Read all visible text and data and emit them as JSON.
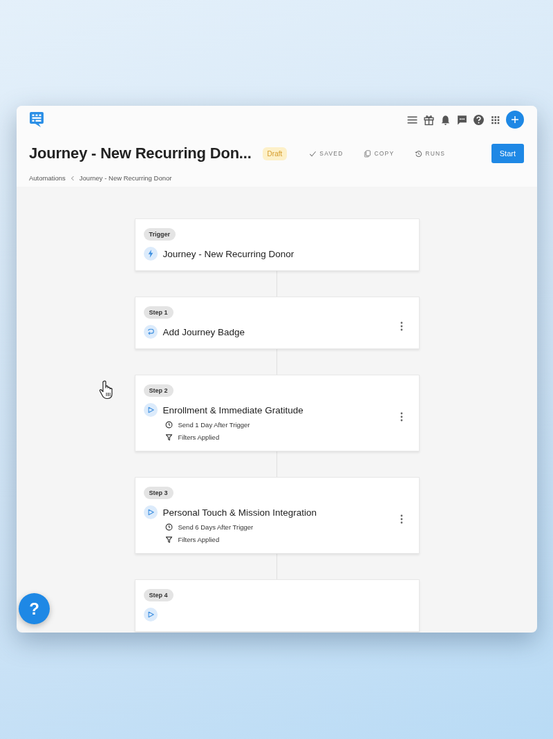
{
  "header": {
    "title": "Journey - New Recurring Don...",
    "status": "Draft",
    "actions": [
      {
        "kind": "saved",
        "label": "SAVED"
      },
      {
        "kind": "copy",
        "label": "COPY"
      },
      {
        "kind": "runs",
        "label": "RUNS"
      }
    ],
    "primary_button": "Start"
  },
  "breadcrumb": [
    "Automations",
    "Journey - New Recurring Donor"
  ],
  "steps": [
    {
      "badge": "Trigger",
      "kind": "trigger",
      "title": "Journey - New Recurring Donor",
      "menu": false
    },
    {
      "badge": "Step 1",
      "kind": "badge",
      "title": "Add Journey Badge",
      "menu": true
    },
    {
      "badge": "Step 2",
      "kind": "send",
      "title": "Enrollment & Immediate Gratitude",
      "menu": true,
      "details": [
        {
          "kind": "clock",
          "text": "Send 1 Day After Trigger"
        },
        {
          "kind": "filter",
          "text": "Filters Applied"
        }
      ]
    },
    {
      "badge": "Step 3",
      "kind": "send",
      "title": "Personal Touch & Mission Integration",
      "menu": true,
      "details": [
        {
          "kind": "clock",
          "text": "Send 6 Days After Trigger"
        },
        {
          "kind": "filter",
          "text": "Filters Applied"
        }
      ]
    },
    {
      "badge": "Step 4",
      "kind": "send",
      "menu": false
    }
  ],
  "help_button": "?"
}
